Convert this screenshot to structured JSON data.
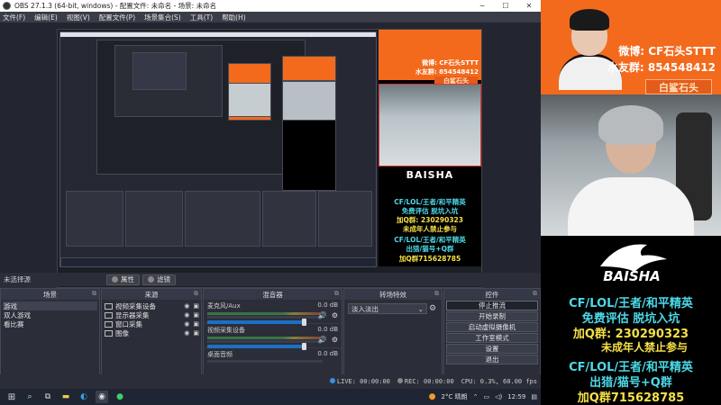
{
  "window": {
    "title": "OBS 27.1.3 (64-bit, windows) - 配置文件: 未命名 - 场景: 未命名",
    "controls": [
      "─",
      "☐",
      "✕"
    ]
  },
  "menu": [
    "文件(F)",
    "编辑(E)",
    "视图(V)",
    "配置文件(P)",
    "场景集合(S)",
    "工具(T)",
    "帮助(H)"
  ],
  "preview": {
    "nested_promo": {
      "weibo": "微博: CF石头STTT",
      "fans": "水友群: 854548412",
      "name": "白鲨石头",
      "line1": "CF/LOL/王者/和平精英",
      "line2": "免费评估  脱坑入坑",
      "line3": "加Q群: 230290323",
      "line4": "未成年人禁止参与",
      "line5": "CF/LOL/王者/和平精英",
      "line6": "出猎/猫号+Q群",
      "line7": "加Q群715628785",
      "logo": "BAISHA"
    }
  },
  "labelbar": {
    "no_source": "未选择源",
    "properties": "属性",
    "filters": "滤镜"
  },
  "scenes": {
    "title": "场景",
    "items": [
      "游戏",
      "双人游戏",
      "看比赛"
    ]
  },
  "sources": {
    "title": "来源",
    "items": [
      "视频采集设备",
      "显示器采集",
      "窗口采集",
      "图像"
    ]
  },
  "mixer": {
    "title": "混音器",
    "items": [
      {
        "name": "麦克风/Aux",
        "db": "0.0 dB"
      },
      {
        "name": "视频采集设备",
        "db": "0.0 dB"
      },
      {
        "name": "桌面音频",
        "db": "0.0 dB"
      }
    ]
  },
  "transitions": {
    "title": "转场特效",
    "selected": "淡入淡出"
  },
  "controls": {
    "title": "控件",
    "buttons": [
      "停止推流",
      "开始录制",
      "启动虚拟摄像机",
      "工作室模式",
      "设置",
      "退出"
    ]
  },
  "status": {
    "live": "LIVE: 00:00:00",
    "rec": "REC: 00:00:00",
    "cpu": "CPU: 0.3%, 60.00 fps"
  },
  "taskbar": {
    "weather": "2°C 晴朗",
    "time": "12:59"
  },
  "overlay": {
    "weibo": "微博: CF石头STTT",
    "fans": "水友群: 854548412",
    "name": "白鲨石头",
    "logo": "BAISHA",
    "line1": "CF/LOL/王者/和平精英",
    "line2": "免费评估  脱坑入坑",
    "line3": "加Q群: 230290323",
    "line4": "未成年人禁止参与",
    "line5": "CF/LOL/王者/和平精英",
    "line6": "出猎/猫号+Q群",
    "line7": "加Q群715628785"
  },
  "colors": {
    "orange": "#f36a1d",
    "cyan": "#4dd9e8",
    "yellow": "#f5e046",
    "obs_bg": "#2b2e38"
  }
}
